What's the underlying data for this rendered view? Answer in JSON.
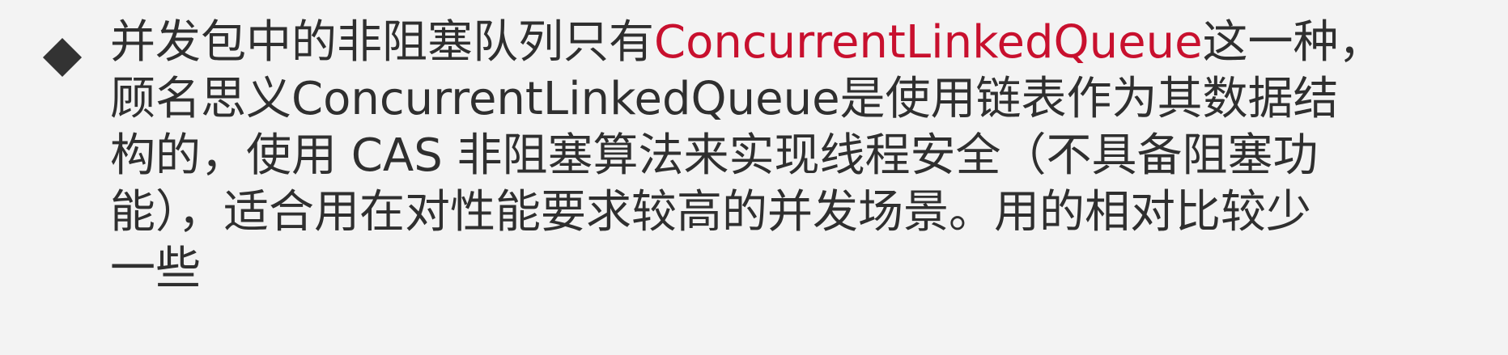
{
  "slide": {
    "lines": [
      {
        "before": "并发包中的非阻塞队列只有",
        "highlight": "ConcurrentLinkedQueue",
        "after": "这一种，"
      },
      {
        "text": "顾名思义ConcurrentLinkedQueue是使用链表作为其数据结"
      },
      {
        "text": "构的，使用 CAS 非阻塞算法来实现线程安全（不具备阻塞功"
      },
      {
        "text": "能），适合用在对性能要求较高的并发场景。用的相对比较少"
      },
      {
        "text": "一些"
      }
    ],
    "colors": {
      "text": "#2f2f2f",
      "highlight": "#c8102e",
      "bullet": "#333333",
      "background": "#f3f3f3"
    },
    "bullet_icon": "diamond-bullet-icon"
  }
}
